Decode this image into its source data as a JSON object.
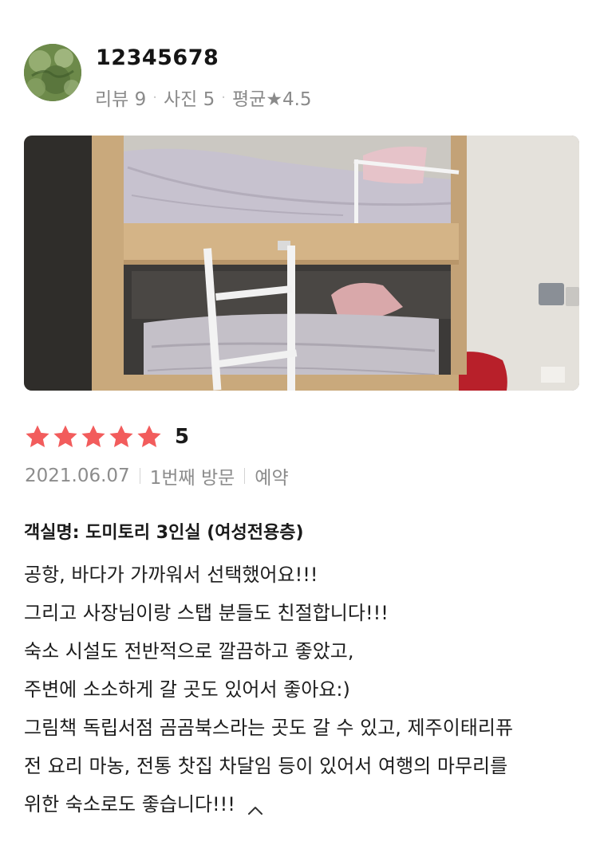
{
  "reviewer": {
    "name": "12345678",
    "stats": [
      {
        "label": "리뷰 9"
      },
      {
        "label": "사진 5"
      },
      {
        "label": "평균★4.5"
      }
    ]
  },
  "review": {
    "rating": 5,
    "rating_label": "5",
    "rating_max": 5,
    "date": "2021.06.07",
    "visit": "1번째 방문",
    "booking": "예약",
    "room_name": "객실명: 도미토리 3인실 (여성전용층)",
    "lines": [
      "공항, 바다가 가까워서 선택했어요!!!",
      "그리고 사장님이랑 스탭 분들도 친절합니다!!!",
      "숙소 시설도 전반적으로 깔끔하고 좋았고,",
      "주변에 소소하게 갈 곳도 있어서 좋아요:)",
      "그림책 독립서점 곰곰북스라는 곳도 갈 수 있고, 제주이태리퓨",
      "전 요리 마농, 전통 찻집 차달임 등이 있어서 여행의 마무리를",
      "위한 숙소로도 좋습니다!!!"
    ]
  },
  "icons": {
    "star": "star-icon",
    "collapse": "chevron-up-icon"
  },
  "colors": {
    "star": "#f25c5c",
    "muted_text": "#8a8a8a",
    "divider": "#d3d3d3"
  }
}
